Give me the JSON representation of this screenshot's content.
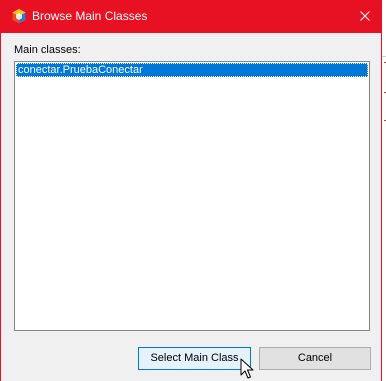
{
  "window": {
    "title": "Browse Main Classes"
  },
  "main_classes": {
    "label": "Main classes:",
    "items": [
      "conectar.PruebaConectar"
    ],
    "selected_index": 0
  },
  "buttons": {
    "select_label": "Select Main Class",
    "cancel_label": "Cancel"
  },
  "colors": {
    "titlebar": "#e81123",
    "selection": "#0078d7",
    "dialog_bg": "#f0f0f0"
  },
  "icons": {
    "app": "netbeans-app-icon",
    "close": "close-icon",
    "cursor": "mouse-pointer-icon"
  }
}
